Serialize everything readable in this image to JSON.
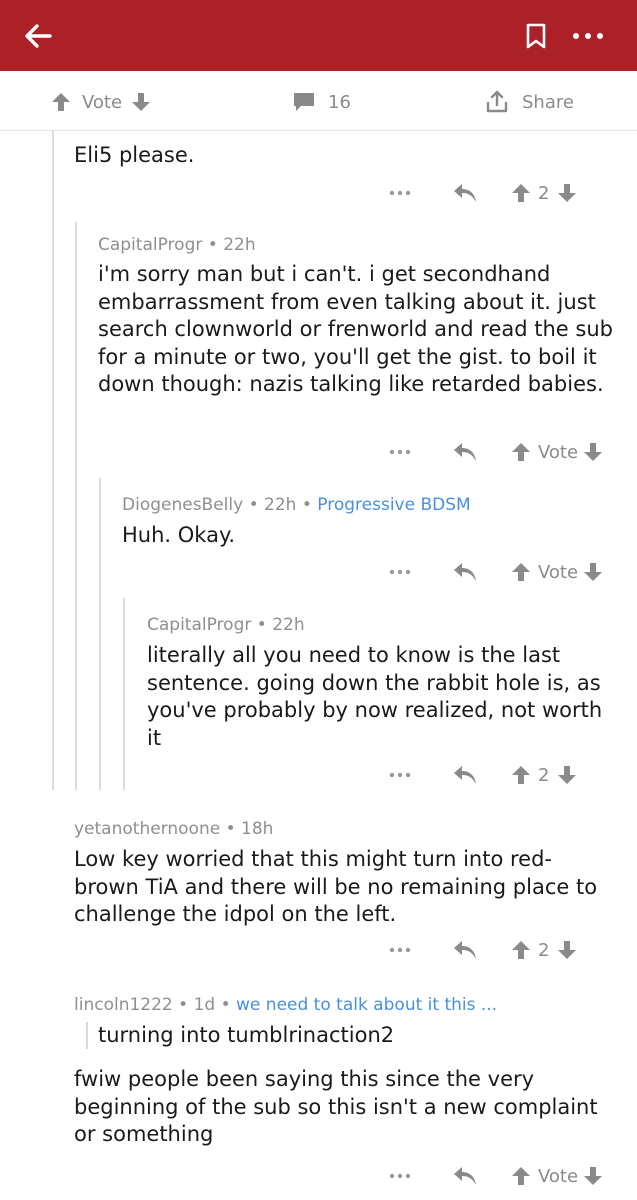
{
  "header": {
    "back_icon": "back-arrow-icon",
    "bookmark_icon": "bookmark-icon",
    "more_icon": "more-dots-icon",
    "color": "#ab2127"
  },
  "post_actions": {
    "vote_label": "Vote",
    "comment_count": "16",
    "share_label": "Share"
  },
  "comments": [
    {
      "author": "",
      "age": "",
      "flair": "",
      "body": "Eli5 please.",
      "score": "2"
    },
    {
      "author": "CapitalProgr",
      "age": "22h",
      "flair": "",
      "body": "i'm sorry man but i can't. i get secondhand embarrassment from even talking about it. just search clownworld or frenworld and read the sub for a minute or two, you'll get the gist. to boil it down though: nazis talking like retarded babies.",
      "score": "Vote"
    },
    {
      "author": "DiogenesBelly",
      "age": "22h",
      "flair": "Progressive BDSM",
      "body": "Huh.  Okay.",
      "score": "Vote"
    },
    {
      "author": "CapitalProgr",
      "age": "22h",
      "flair": "",
      "body": "literally all you need to know is the last sentence. going down the rabbit hole is, as you've probably by now realized, not worth it",
      "score": "2"
    },
    {
      "author": "yetanothernoone",
      "age": "18h",
      "flair": "",
      "body": "Low key worried that this might turn into red-brown TiA and there will be no remaining place to challenge the idpol on the left.",
      "score": "2"
    },
    {
      "author": "lincoln1222",
      "age": "1d",
      "flair": "we need to talk about it this ...",
      "quote": "turning into tumblrinaction2",
      "body": "fwiw people been saying this since the very beginning of the sub so this isn't a new complaint or something",
      "score": "Vote"
    }
  ],
  "meta_separator": "•"
}
